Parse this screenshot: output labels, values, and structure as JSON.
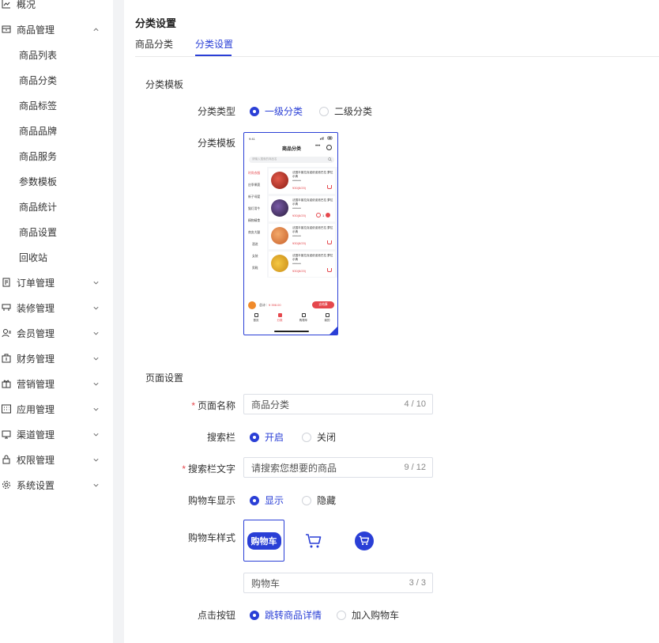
{
  "sidebar": {
    "overview": "概况",
    "goods_management": "商品管理",
    "sub_items": [
      "商品列表",
      "商品分类",
      "商品标签",
      "商品品牌",
      "商品服务",
      "参数模板",
      "商品统计",
      "商品设置",
      "回收站"
    ],
    "menus": [
      "订单管理",
      "装修管理",
      "会员管理",
      "财务管理",
      "营销管理",
      "应用管理",
      "渠道管理",
      "权限管理",
      "系统设置"
    ]
  },
  "header": {
    "title": "分类设置",
    "tabs": [
      "商品分类",
      "分类设置"
    ],
    "active_tab": "分类设置"
  },
  "template_section": {
    "title": "分类模板",
    "category_type_label": "分类类型",
    "category_type_options": [
      "一级分类",
      "二级分类"
    ],
    "category_type_selected": "一级分类",
    "template_label": "分类模板"
  },
  "phone_preview": {
    "status_time": "9:41",
    "title": "商品分类",
    "more": "•••",
    "search_placeholder": "请输入搜索的商品名",
    "categories": [
      "时尚衣服",
      "应季果蔬",
      "新子母婴",
      "猫灯用牛",
      "精物精食",
      "商务大腿",
      "酒进",
      "女装",
      "男鞋"
    ],
    "product_name": "法国丰普拉克诺依诺依巴拉 萝拉示典",
    "product_orig": "¥150.00",
    "product_price": "¥30(8/20)",
    "step_qty": "1",
    "total_label": "总计：",
    "total_value": "¥ 398.00",
    "settle": "去结算",
    "nav": [
      "首页",
      "分类",
      "购物车",
      "我的"
    ]
  },
  "page_section": {
    "title": "页面设置",
    "page_name_label": "页面名称",
    "page_name_value": "商品分类",
    "page_name_count": "4 / 10",
    "search_bar_label": "搜索栏",
    "search_bar_options": [
      "开启",
      "关闭"
    ],
    "search_text_label": "搜索栏文字",
    "search_text_value": "请搜索您想要的商品",
    "search_text_count": "9 / 12",
    "cart_display_label": "购物车显示",
    "cart_display_options": [
      "显示",
      "隐藏"
    ],
    "cart_style_label": "购物车样式",
    "cart_pill_text": "购物车",
    "cart_text_value": "购物车",
    "cart_text_count": "3 / 3",
    "click_label": "点击按钮",
    "click_options": [
      "跳转商品详情",
      "加入购物车"
    ]
  },
  "colors": {
    "accent": "#2a3fd6",
    "danger": "#e5484d"
  }
}
